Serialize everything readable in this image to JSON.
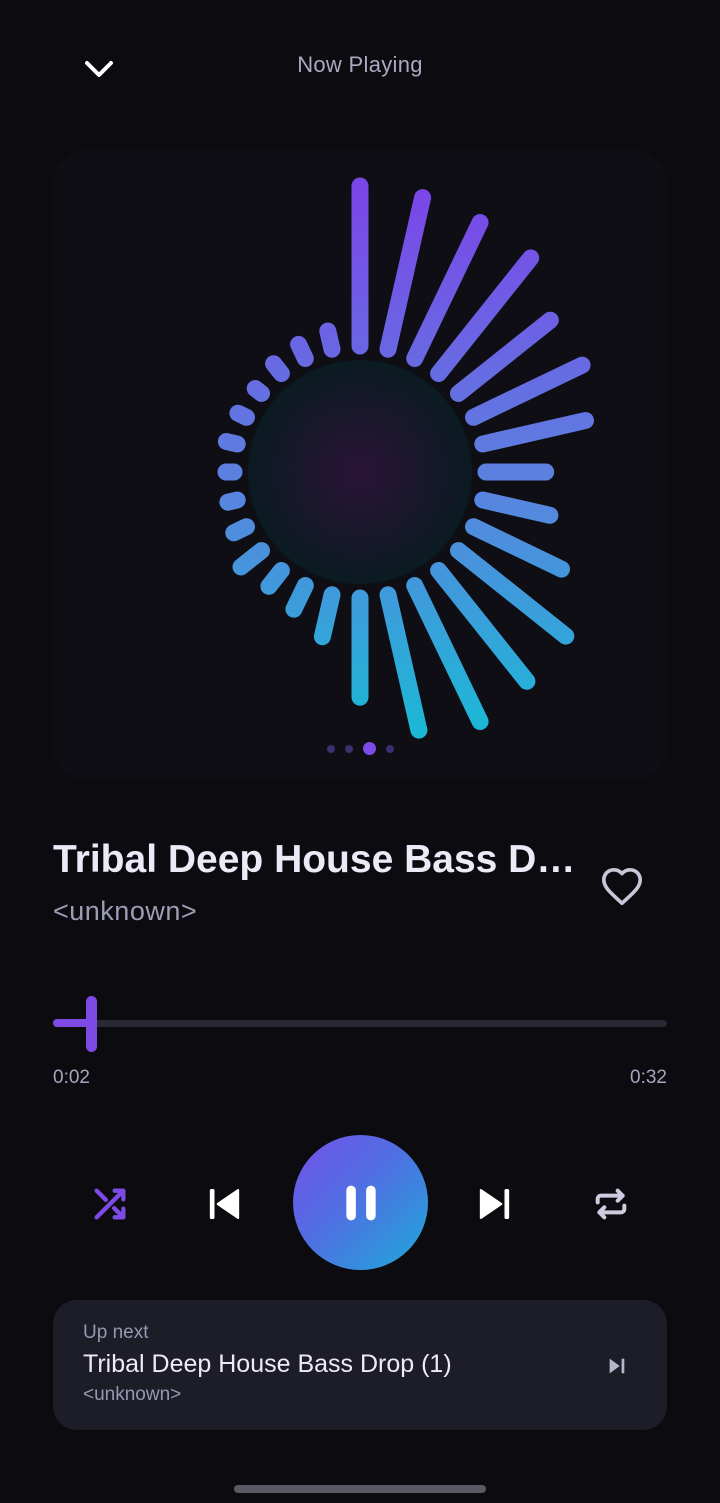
{
  "header": {
    "title": "Now Playing",
    "collapse_icon": "chevron-down-icon"
  },
  "visualizer": {
    "pages": 4,
    "active_page": 3,
    "bar_levels": [
      1.0,
      0.97,
      0.94,
      0.92,
      0.72,
      0.74,
      0.64,
      0.34,
      0.4,
      0.59,
      0.85,
      0.88,
      0.94,
      0.86,
      0.6,
      0.23,
      0.12,
      0.08,
      0.12,
      0.04,
      0.01,
      0.0,
      0.02,
      0.01,
      0.0,
      0.03,
      0.05,
      0.07
    ],
    "gradient_start": "#7b46e8",
    "gradient_end": "#1cb8d6"
  },
  "track": {
    "title": "Tribal Deep House Bass Drop",
    "artist": "<unknown>",
    "favorite_icon": "heart-outline-icon"
  },
  "progress": {
    "elapsed": "0:02",
    "total": "0:32",
    "fraction": 0.0625
  },
  "controls": {
    "shuffle_icon": "shuffle-icon",
    "shuffle_active": true,
    "previous_icon": "skip-previous-icon",
    "play_pause_icon": "pause-icon",
    "next_icon": "skip-next-icon",
    "repeat_icon": "repeat-icon"
  },
  "up_next": {
    "label": "Up next",
    "title": "Tribal Deep House Bass Drop (1)",
    "artist": "<unknown>",
    "skip_icon": "skip-next-small-icon"
  },
  "colors": {
    "background": "#0b0b10",
    "accent": "#7e4ae6",
    "card": "#1d1d28"
  }
}
